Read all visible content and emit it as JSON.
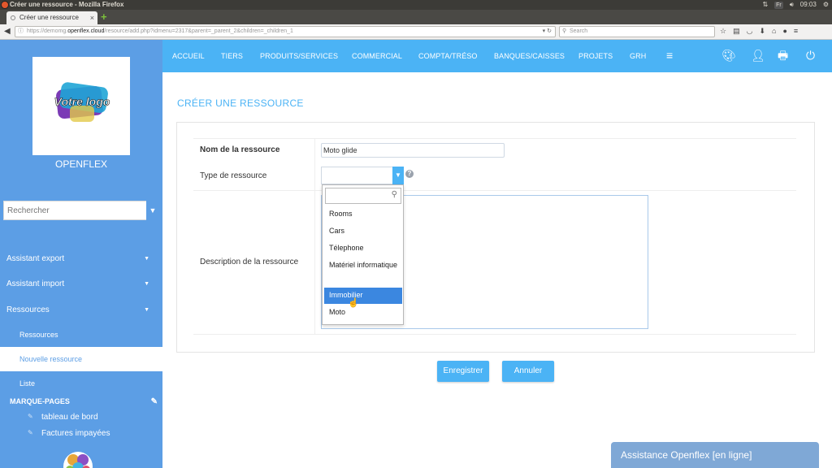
{
  "window": {
    "title": "Créer une ressource - Mozilla Firefox",
    "lang": "Fr",
    "time": "09:03"
  },
  "browser": {
    "tab_label": "Créer une ressource",
    "url_prefix": "https://demomg.",
    "url_domain": "openflex.cloud",
    "url_rest": "/resource/add.php?idmenu=2317&parent=_parent_2&children=_children_1",
    "search_placeholder": "Search"
  },
  "sidebar": {
    "logo_text": "Votre logo",
    "company": "OPENFLEX",
    "search_placeholder": "Rechercher",
    "items": [
      {
        "label": "Assistant export"
      },
      {
        "label": "Assistant import"
      },
      {
        "label": "Ressources"
      }
    ],
    "subitems": [
      {
        "label": "Ressources"
      },
      {
        "label": "Nouvelle ressource"
      },
      {
        "label": "Liste"
      }
    ],
    "bookmarks_title": "MARQUE-PAGES",
    "bookmarks": [
      {
        "label": "tableau de bord"
      },
      {
        "label": "Factures impayées"
      }
    ]
  },
  "topnav": {
    "items": [
      "ACCUEIL",
      "TIERS",
      "PRODUITS/SERVICES",
      "COMMERCIAL",
      "COMPTA/TRÉSO",
      "BANQUES/CAISSES",
      "PROJETS",
      "GRH"
    ]
  },
  "form": {
    "title": "CRÉER UNE RESSOURCE",
    "name_label": "Nom de la ressource",
    "name_value": "Moto glide",
    "type_label": "Type de ressource",
    "description_label": "Description de la ressource",
    "type_options": [
      {
        "label": "Rooms"
      },
      {
        "label": "Cars"
      },
      {
        "label": "Télephone"
      },
      {
        "label": "Matériel informatique"
      },
      {
        "label": "Immobilier"
      },
      {
        "label": "Moto"
      }
    ],
    "highlighted_option": "Immobilier",
    "save_label": "Enregistrer",
    "cancel_label": "Annuler"
  },
  "assistance": {
    "label": "Assistance Openflex [en ligne]"
  },
  "colors": {
    "sidebar": "#5c9ee5",
    "topnav": "#4bb3f5",
    "highlight": "#3b87e0"
  }
}
